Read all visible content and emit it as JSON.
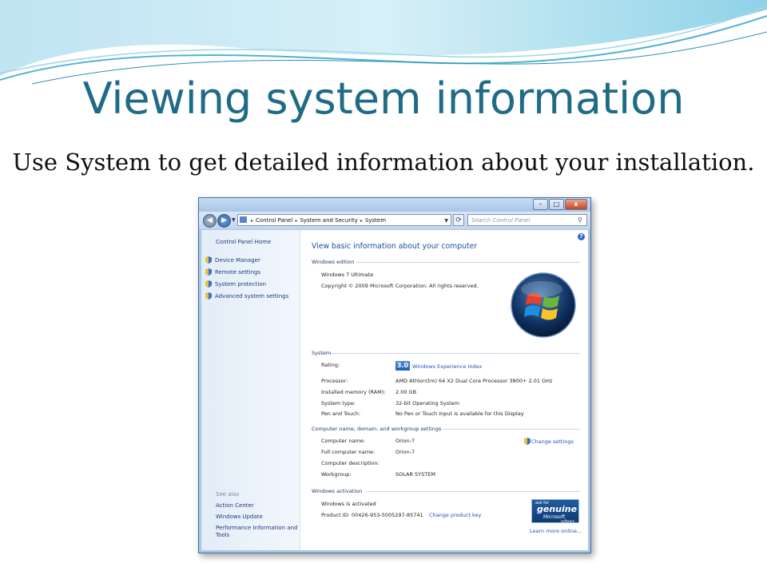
{
  "slide": {
    "title": "Viewing system information",
    "subtitle": "Use System to get detailed information about your installation."
  },
  "window": {
    "caption_buttons": {
      "minimize": "–",
      "maximize": "□",
      "close": "x"
    },
    "nav": {
      "back_icon": "back-arrow-icon",
      "forward_icon": "forward-arrow-icon"
    },
    "address": {
      "crumbs": [
        "Control Panel",
        "System and Security",
        "System"
      ]
    },
    "search": {
      "placeholder": "Search Control Panel"
    }
  },
  "sidebar": {
    "home": "Control Panel Home",
    "tasks": [
      "Device Manager",
      "Remote settings",
      "System protection",
      "Advanced system settings"
    ],
    "see_also_label": "See also",
    "see_also": [
      "Action Center",
      "Windows Update",
      "Performance Information and",
      "Tools"
    ]
  },
  "main": {
    "heading": "View basic information about your computer",
    "edition": {
      "section": "Windows edition",
      "name": "Windows 7 Ultimate",
      "copyright": "Copyright © 2009 Microsoft Corporation.  All rights reserved."
    },
    "system": {
      "section": "System",
      "rating_label": "Rating:",
      "rating_value": "3.0",
      "rating_link": "Windows Experience Index",
      "processor_label": "Processor:",
      "processor_value": "AMD Athlon(tm) 64 X2 Dual Core Processor 3800+   2.01 GHz",
      "ram_label": "Installed memory (RAM):",
      "ram_value": "2.00 GB",
      "type_label": "System type:",
      "type_value": "32-bit Operating System",
      "pen_label": "Pen and Touch:",
      "pen_value": "No Pen or Touch Input is available for this Display"
    },
    "computer": {
      "section": "Computer name, domain, and workgroup settings",
      "change_link": "Change settings",
      "name_label": "Computer name:",
      "name_value": "Orion-7",
      "full_label": "Full computer name:",
      "full_value": "Orion-7",
      "desc_label": "Computer description:",
      "desc_value": "",
      "workgroup_label": "Workgroup:",
      "workgroup_value": "SOLAR SYSTEM"
    },
    "activation": {
      "section": "Windows activation",
      "status": "Windows is activated",
      "product_id": "Product ID: 00426-953-5005297-85741",
      "change_key": "Change product key",
      "genuine": {
        "ask": "ask for",
        "word": "genuine",
        "brand": "Microsoft",
        "sw": "software"
      },
      "learn_more": "Learn more online..."
    }
  },
  "colors": {
    "title": "#1f6b86",
    "link": "#1f52c4",
    "heading": "#1e4fa0"
  }
}
